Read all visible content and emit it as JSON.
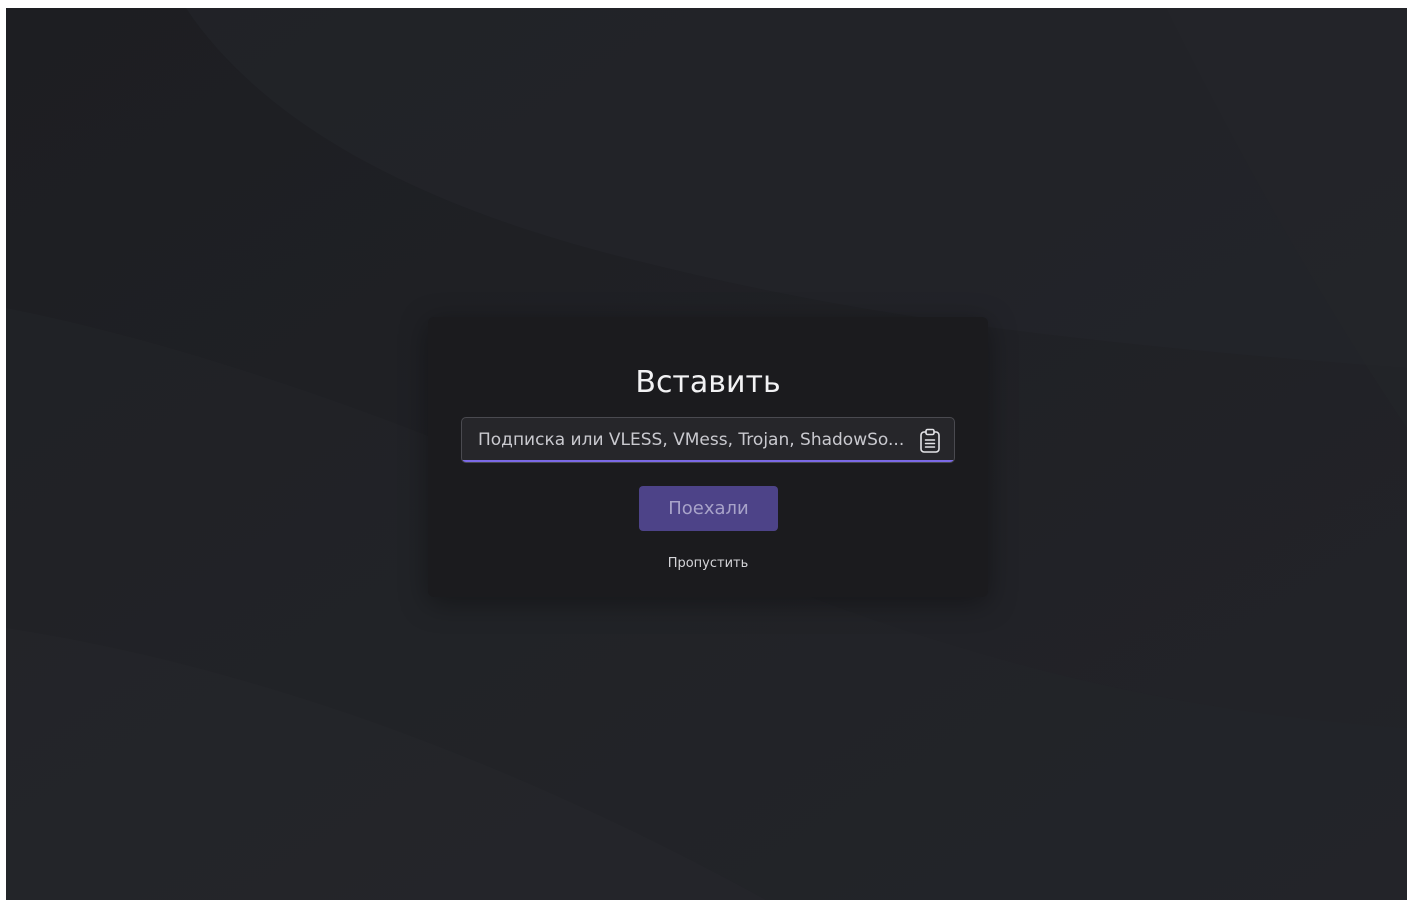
{
  "dialog": {
    "title": "Вставить",
    "input": {
      "value": "",
      "placeholder": "Подписка или VLESS, VMess, Trojan, ShadowSo..."
    },
    "paste_icon": "clipboard-icon",
    "go_label": "Поехали",
    "skip_label": "Пропустить"
  },
  "colors": {
    "background": "#1f2024",
    "dialog": "#1b1b1e",
    "accent": "#7b69e6",
    "button": "#4d4388"
  }
}
